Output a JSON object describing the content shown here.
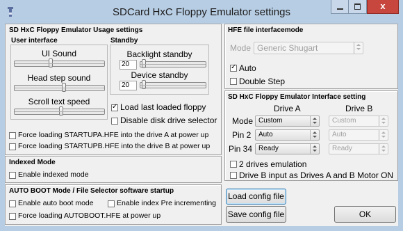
{
  "window": {
    "title": "SDCard HxC Floppy Emulator settings",
    "close_label": "x"
  },
  "usage": {
    "title": "SD HxC Floppy Emulator Usage settings",
    "ui_title": "User interface",
    "ui_sound": "UI Sound",
    "head_step_sound": "Head step sound",
    "scroll_text_speed": "Scroll text speed",
    "ui_sound_level": 0.4,
    "head_step_level": 0.55,
    "scroll_speed_level": 0.52,
    "standby_title": "Standby",
    "backlight_standby": "Backlight standby",
    "backlight_value": "20",
    "device_standby": "Device standby",
    "device_value": "20",
    "load_last": "Load last loaded floppy",
    "load_last_checked": true,
    "disable_selector": "Disable disk drive selector",
    "disable_selector_checked": false,
    "force_a": "Force loading STARTUPA.HFE into the drive A at power up",
    "force_b": "Force loading STARTUPB.HFE into the drive B at power up"
  },
  "indexed": {
    "title": "Indexed Mode",
    "enable": "Enable indexed mode"
  },
  "autoboot": {
    "title": "AUTO BOOT Mode / File Selector software startup",
    "enable_autoboot": "Enable auto boot mode",
    "enable_index_pre": "Enable index Pre incrementing",
    "force_autoboot": "Force loading AUTOBOOT.HFE at power up"
  },
  "hfe": {
    "title": "HFE file interfacemode",
    "mode_label": "Mode",
    "mode_value": "Generic Shugart",
    "auto_label": "Auto",
    "auto_checked": true,
    "double_step": "Double Step",
    "double_step_checked": false
  },
  "iface": {
    "title": "SD HxC Floppy Emulator Interface setting",
    "drive_a": "Drive A",
    "drive_b": "Drive B",
    "mode_label": "Mode",
    "pin2_label": "Pin 2",
    "pin34_label": "Pin 34",
    "a_mode": "Custom",
    "a_pin2": "Auto",
    "a_pin34": "Ready",
    "b_mode": "Custom",
    "b_pin2": "Auto",
    "b_pin34": "Ready",
    "two_drives": "2 drives emulation",
    "drive_b_input": "Drive B input as Drives A and B Motor ON"
  },
  "buttons": {
    "load": "Load config file",
    "save": "Save config file",
    "ok": "OK"
  }
}
